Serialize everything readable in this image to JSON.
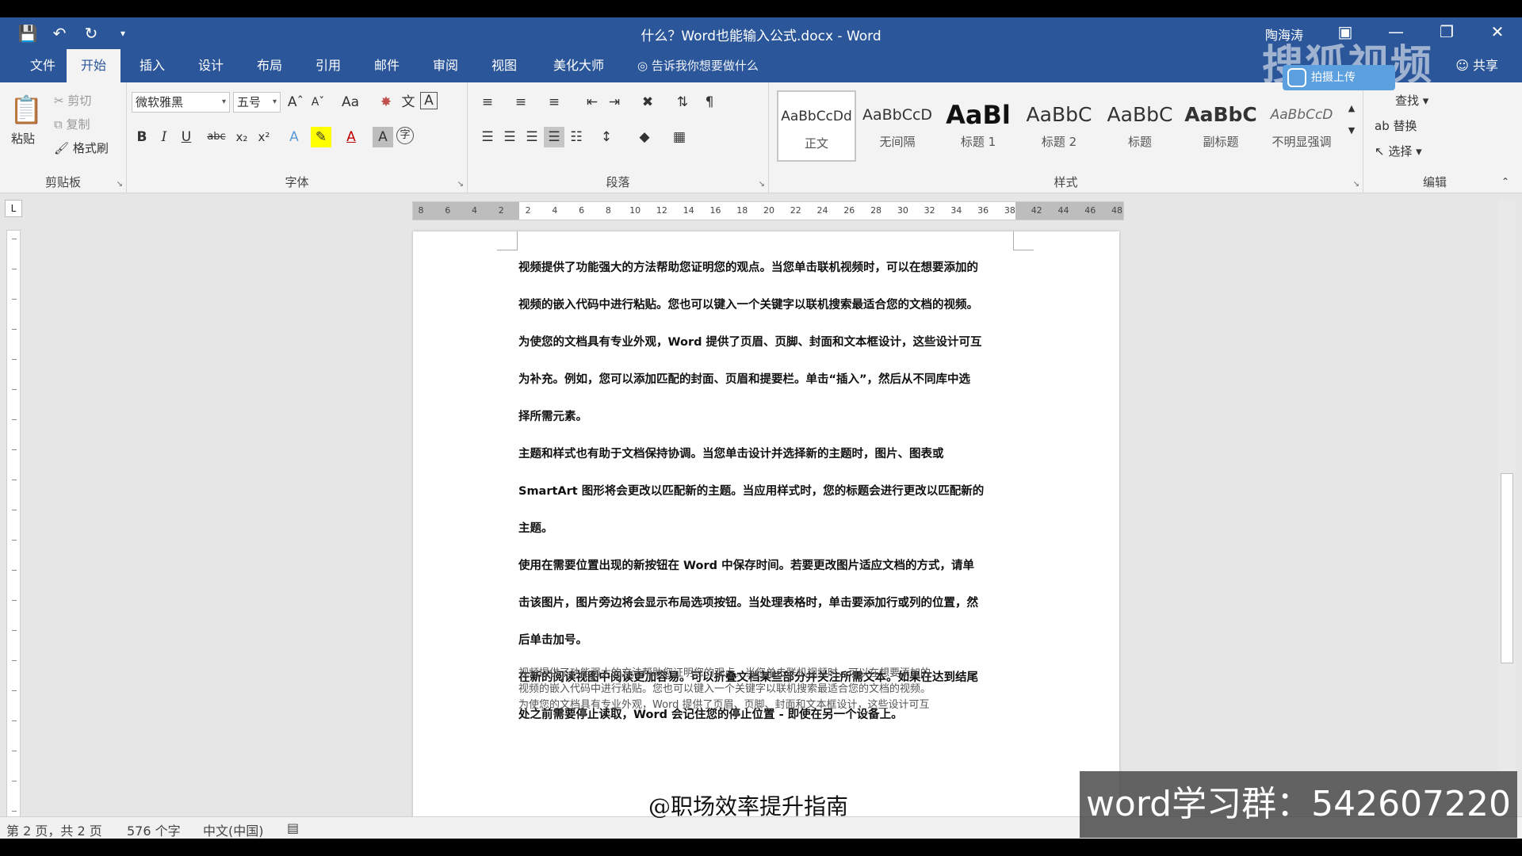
{
  "title_bar": {
    "document_title": "什么？Word也能输入公式.docx - Word",
    "user_name": "陶海涛",
    "quick_access": [
      "save-icon",
      "undo-icon",
      "redo-icon",
      "customize-icon"
    ],
    "window_buttons": [
      "ribbon-display-icon",
      "minimize-icon",
      "restore-icon",
      "close-icon"
    ]
  },
  "tabs": [
    "文件",
    "开始",
    "插入",
    "设计",
    "布局",
    "引用",
    "邮件",
    "审阅",
    "视图",
    "美化大师"
  ],
  "active_tab": "开始",
  "tell_me": "告诉我你想要做什么",
  "share_label": "共享",
  "clipboard": {
    "paste": "粘贴",
    "cut": "剪切",
    "copy": "复制",
    "format_painter": "格式刷",
    "label": "剪贴板"
  },
  "font": {
    "name": "微软雅黑",
    "size": "五号",
    "change_case": "Aa",
    "bold": "B",
    "italic": "I",
    "underline": "U",
    "strikethrough": "abc",
    "subscript": "x₂",
    "superscript": "x²",
    "label": "字体"
  },
  "paragraph": {
    "label": "段落"
  },
  "styles": {
    "label": "样式",
    "items": [
      {
        "sample": "AaBbCcDd",
        "name": "正文"
      },
      {
        "sample": "AaBbCcD",
        "name": "无间隔"
      },
      {
        "sample": "AaBl",
        "name": "标题 1"
      },
      {
        "sample": "AaBbC",
        "name": "标题 2"
      },
      {
        "sample": "AaBbC",
        "name": "标题"
      },
      {
        "sample": "AaBbC",
        "name": "副标题"
      },
      {
        "sample": "AaBbCcD",
        "name": "不明显强调"
      }
    ]
  },
  "editing": {
    "find": "查找",
    "replace": "替换",
    "select": "选择",
    "label": "编辑"
  },
  "ruler": {
    "ticks": [
      "8",
      "6",
      "4",
      "2",
      "2",
      "4",
      "6",
      "8",
      "10",
      "12",
      "14",
      "16",
      "18",
      "20",
      "22",
      "24",
      "26",
      "28",
      "30",
      "32",
      "34",
      "36",
      "38",
      "42",
      "44",
      "46",
      "48"
    ]
  },
  "document": {
    "lines": [
      "视频提供了功能强大的方法帮助您证明您的观点。当您单击联机视频时，可以在想要添加的",
      "视频的嵌入代码中进行粘贴。您也可以键入一个关键字以联机搜索最适合您的文档的视频。",
      "为使您的文档具有专业外观，Word 提供了页眉、页脚、封面和文本框设计，这些设计可互",
      "为补充。例如，您可以添加匹配的封面、页眉和提要栏。单击“插入”，然后从不同库中选",
      "择所需元素。",
      "主题和样式也有助于文档保持协调。当您单击设计并选择新的主题时，图片、图表或",
      "SmartArt 图形将会更改以匹配新的主题。当应用样式时，您的标题会进行更改以匹配新的",
      "主题。",
      "使用在需要位置出现的新按钮在 Word 中保存时间。若要更改图片适应文档的方式，请单",
      "击该图片，图片旁边将会显示布局选项按钮。当处理表格时，单击要添加行或列的位置，然",
      "后单击加号。",
      "在新的阅读视图中阅读更加容易。可以折叠文档某些部分并关注所需文本。如果在达到结尾",
      "处之前需要停止读取，Word 会记住您的停止位置 - 即使在另一个设备上。"
    ],
    "small_lines": [
      "视频提供了功能强大的方法帮助您证明您的观点。当您单击联机视频时，可以在想要添加的",
      "视频的嵌入代码中进行粘贴。您也可以键入一个关键字以联机搜索最适合您的文档的视频。",
      "为使您的文档具有专业外观，Word 提供了页眉、页脚、封面和文本框设计，这些设计可互"
    ]
  },
  "status_bar": {
    "page_info": "第 2 页，共 2 页",
    "word_count": "576 个字",
    "language": "中文(中国)"
  },
  "overlays": {
    "watermark": "搜狐视频",
    "upload_button": "拍摄上传",
    "caption": "@职场效率提升指南",
    "banner": "word学习群：542607220"
  },
  "colors": {
    "accent": "#2b579a",
    "ribbon_bg": "#f3f3f3",
    "workspace_bg": "#e6e6e6"
  }
}
